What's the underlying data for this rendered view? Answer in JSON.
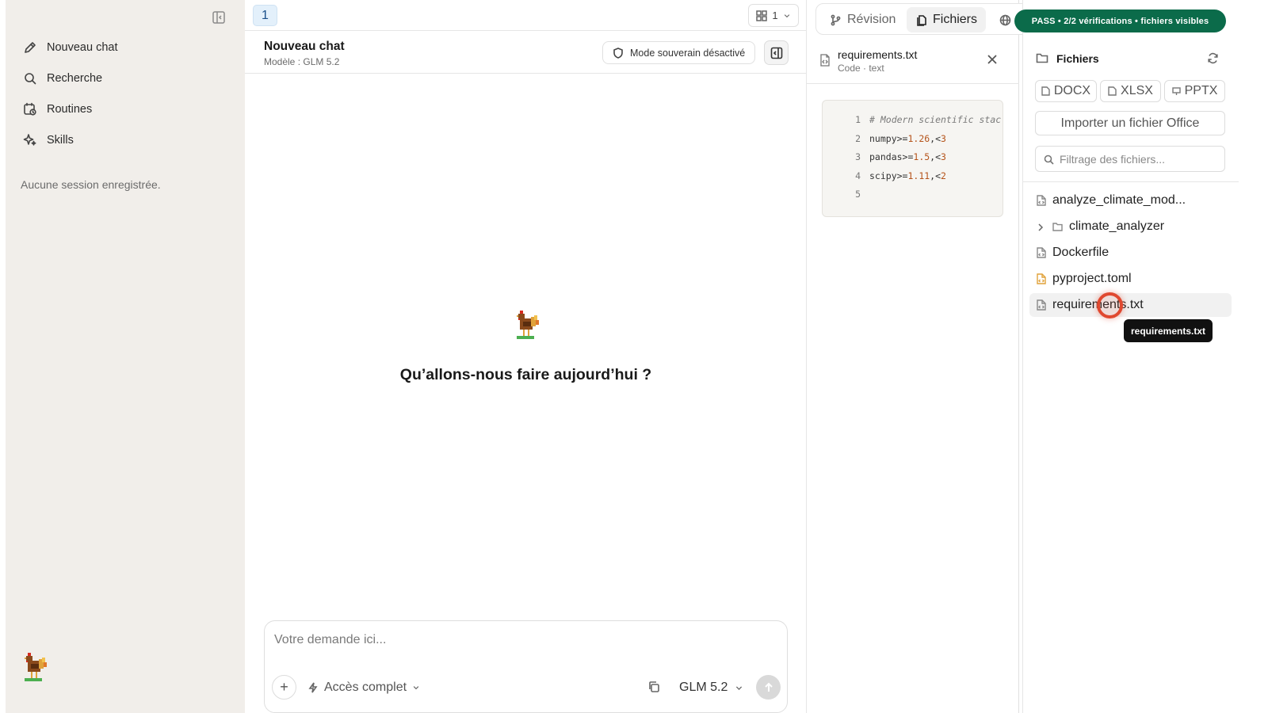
{
  "sidebar": {
    "items": [
      {
        "label": "Nouveau chat",
        "icon": "pencil-icon"
      },
      {
        "label": "Recherche",
        "icon": "search-icon"
      },
      {
        "label": "Routines",
        "icon": "calendar-clock-icon"
      },
      {
        "label": "Skills",
        "icon": "sparkle-icon"
      }
    ],
    "empty_text": "Aucune session enregistrée."
  },
  "chat": {
    "tab_number": "1",
    "grid_count": "1",
    "title": "Nouveau chat",
    "model_line": "Modèle : GLM 5.2",
    "sovereign_label": "Mode souverain désactivé",
    "hero_text": "Qu’allons-nous faire aujourd’hui ?",
    "composer": {
      "placeholder": "Votre demande ici...",
      "access_label": "Accès complet",
      "model_label": "GLM 5.2"
    }
  },
  "top_tabs": [
    {
      "label": "Révision",
      "icon": "git-branch-icon"
    },
    {
      "label": "Fichiers",
      "icon": "files-icon"
    }
  ],
  "preview": {
    "file_name": "requirements.txt",
    "file_meta": "Code · text",
    "lines": [
      {
        "n": "1",
        "parts": [
          {
            "t": "# Modern scientific stac",
            "c": "cm"
          }
        ]
      },
      {
        "n": "2",
        "parts": [
          {
            "t": "numpy>=",
            "c": "op"
          },
          {
            "t": "1.26",
            "c": "num"
          },
          {
            "t": ",<",
            "c": "op"
          },
          {
            "t": "3",
            "c": "num"
          }
        ]
      },
      {
        "n": "3",
        "parts": [
          {
            "t": "pandas>=",
            "c": "op"
          },
          {
            "t": "1.5",
            "c": "num"
          },
          {
            "t": ",<",
            "c": "op"
          },
          {
            "t": "3",
            "c": "num"
          }
        ]
      },
      {
        "n": "4",
        "parts": [
          {
            "t": "scipy>=",
            "c": "op"
          },
          {
            "t": "1.11",
            "c": "num"
          },
          {
            "t": ",<",
            "c": "op"
          },
          {
            "t": "2",
            "c": "num"
          }
        ]
      },
      {
        "n": "5",
        "parts": []
      }
    ]
  },
  "files": {
    "title": "Fichiers",
    "formats": [
      "DOCX",
      "XLSX",
      "PPTX"
    ],
    "import_label": "Importer un fichier Office",
    "filter_placeholder": "Filtrage des fichiers...",
    "tree": [
      {
        "label": "analyze_climate_mod...",
        "type": "file",
        "color": "#888888"
      },
      {
        "label": "climate_analyzer",
        "type": "folder",
        "color": "#888888"
      },
      {
        "label": "Dockerfile",
        "type": "file",
        "color": "#888888"
      },
      {
        "label": "pyproject.toml",
        "type": "file",
        "color": "#e0a23a"
      },
      {
        "label": "requirements.txt",
        "type": "file",
        "color": "#888888"
      }
    ]
  },
  "badge": "PASS • 2/2 vérifications • fichiers visibles",
  "tooltip": "requirements.txt",
  "colors": {
    "accent_green": "#0b6b4a",
    "cursor_red": "#e0482f",
    "sidebar_bg": "#f1eeea"
  }
}
